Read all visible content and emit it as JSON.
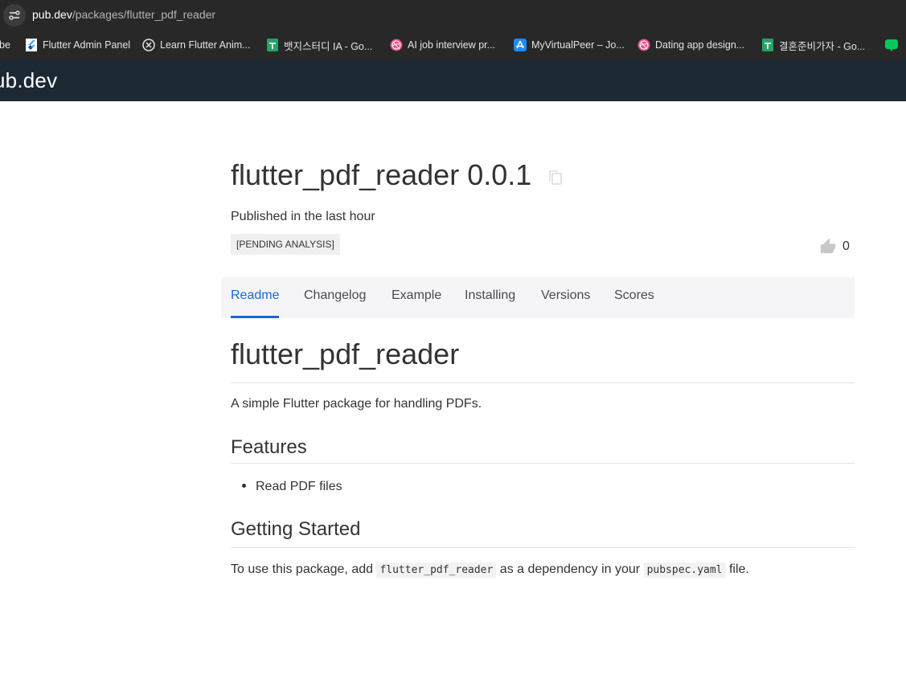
{
  "browser": {
    "url_host": "pub.dev",
    "url_path": "/packages/flutter_pdf_reader",
    "bookmarks": [
      {
        "label": "be",
        "icon": "none"
      },
      {
        "label": "Flutter Admin Panel",
        "icon": "flutter-icon"
      },
      {
        "label": "Learn Flutter Anim...",
        "icon": "x-circle-icon"
      },
      {
        "label": "뱃지스터디 IA - Go...",
        "icon": "google-sheets-icon"
      },
      {
        "label": "AI job interview pr...",
        "icon": "dribbble-icon"
      },
      {
        "label": "MyVirtualPeer – Jo...",
        "icon": "app-store-icon"
      },
      {
        "label": "Dating app design...",
        "icon": "dribbble-icon"
      },
      {
        "label": "결혼준비가자 - Go...",
        "icon": "google-sheets-icon"
      }
    ]
  },
  "site": {
    "logo": "ub.dev"
  },
  "package": {
    "title": "flutter_pdf_reader 0.0.1",
    "published": "Published in the last hour",
    "tag": "[PENDING ANALYSIS]",
    "likes": "0"
  },
  "tabs": [
    {
      "label": "Readme",
      "active": true
    },
    {
      "label": "Changelog",
      "active": false
    },
    {
      "label": "Example",
      "active": false
    },
    {
      "label": "Installing",
      "active": false
    },
    {
      "label": "Versions",
      "active": false
    },
    {
      "label": "Scores",
      "active": false
    }
  ],
  "readme": {
    "title": "flutter_pdf_reader",
    "description": "A simple Flutter package for handling PDFs.",
    "features_heading": "Features",
    "features": [
      "Read PDF files"
    ],
    "getting_started_heading": "Getting Started",
    "getting_started_text_1": "To use this package, add ",
    "getting_started_code_1": "flutter_pdf_reader",
    "getting_started_text_2": " as a dependency in your ",
    "getting_started_code_2": "pubspec.yaml",
    "getting_started_text_3": " file."
  },
  "colors": {
    "header_bg": "#1c2834",
    "active_tab": "#1967d2",
    "tab_bar_bg": "#f5f5f7",
    "browser_bg": "#282828"
  }
}
